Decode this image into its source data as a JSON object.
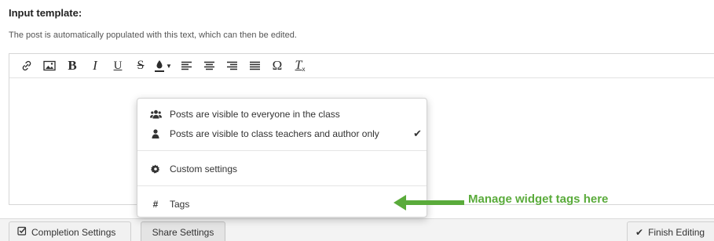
{
  "heading": "Input template:",
  "description": "The post is automatically populated with this text, which can then be edited.",
  "toolbar": {
    "bold": "B",
    "italic": "I",
    "underline": "U",
    "strikethrough": "S",
    "omega": "Ω",
    "clear_format": "T"
  },
  "dropdown": {
    "items": [
      {
        "label": "Posts are visible to everyone in the class",
        "icon": "users-icon"
      },
      {
        "label": "Posts are visible to class teachers and author only",
        "icon": "user-icon",
        "selected": true
      },
      {
        "label": "Custom settings",
        "icon": "gear-icon"
      },
      {
        "label": "Tags",
        "icon": "hash-icon"
      }
    ]
  },
  "annotation": {
    "text": "Manage widget tags here",
    "color": "#5aab3b"
  },
  "bottom_bar": {
    "completion_settings": "Completion Settings",
    "share_settings": "Share Settings",
    "finish_editing": "Finish Editing"
  }
}
